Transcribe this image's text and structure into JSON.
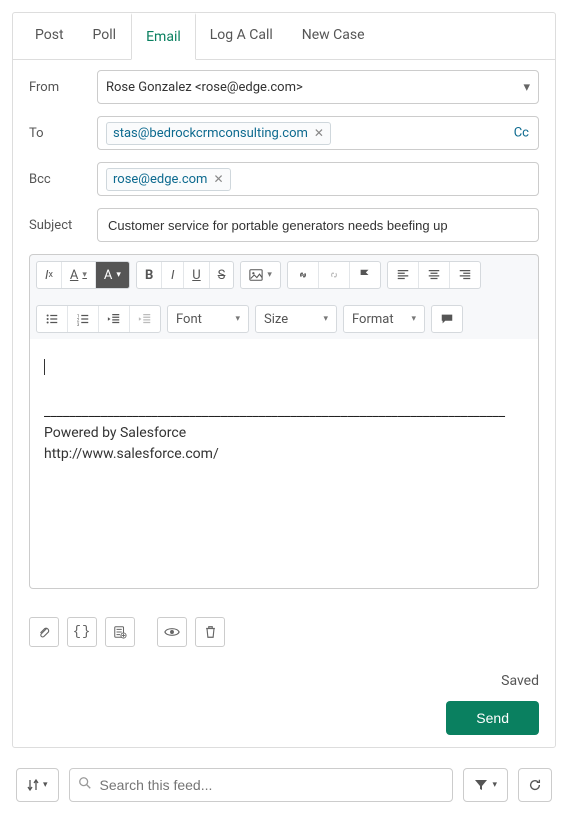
{
  "tabs": {
    "post": "Post",
    "poll": "Poll",
    "email": "Email",
    "log_a_call": "Log A Call",
    "new_case": "New Case"
  },
  "fields": {
    "from_label": "From",
    "from_value": "Rose Gonzalez <rose@edge.com>",
    "to_label": "To",
    "to_chip": "stas@bedrockcrmconsulting.com",
    "cc_label": "Cc",
    "bcc_label": "Bcc",
    "bcc_chip": "rose@edge.com",
    "subject_label": "Subject",
    "subject_value": "Customer service for portable generators needs beefing up"
  },
  "toolbar": {
    "font_label": "Font",
    "size_label": "Size",
    "format_label": "Format"
  },
  "body": {
    "divider": "_________________________________________________________________________",
    "sig1": "Powered by Salesforce",
    "sig2": "http://www.salesforce.com/"
  },
  "status": "Saved",
  "send_label": "Send",
  "footer": {
    "search_placeholder": "Search this feed..."
  }
}
